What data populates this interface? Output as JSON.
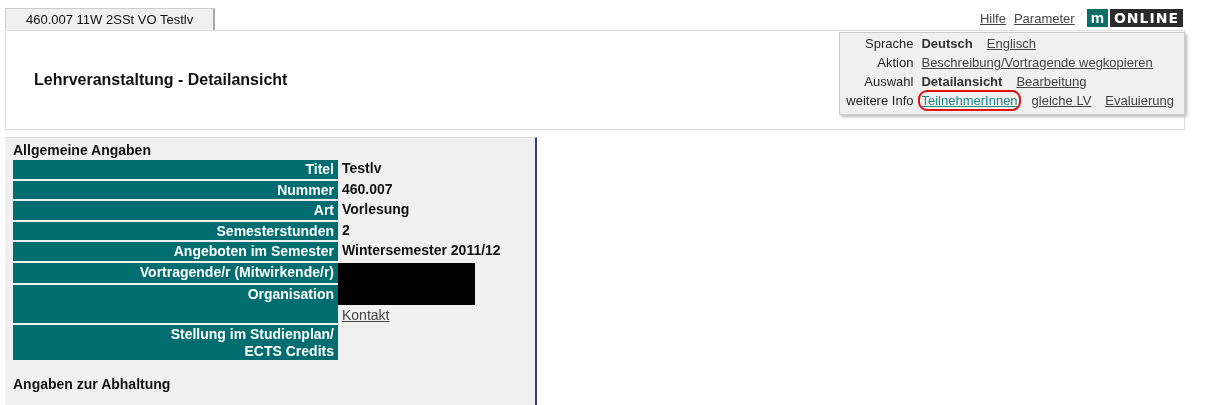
{
  "tab": {
    "label": "460.007 11W 2SSt VO Testlv",
    "selected": true
  },
  "top_links": [
    "Hilfe",
    "Parameter"
  ],
  "logo": {
    "mark": "m",
    "text": "ONLINE"
  },
  "page_title": "Lehrveranstaltung - Detailansicht",
  "menu": [
    {
      "label": "Sprache",
      "items": [
        {
          "text": "Deutsch",
          "selected": true,
          "highlighted": false
        },
        {
          "text": "Englisch",
          "selected": false,
          "highlighted": false
        }
      ]
    },
    {
      "label": "Aktion",
      "items": [
        {
          "text": "Beschreibung/Vortragende wegkopieren",
          "selected": false,
          "highlighted": false
        }
      ]
    },
    {
      "label": "Auswahl",
      "items": [
        {
          "text": "Detailansicht",
          "selected": true,
          "highlighted": false
        },
        {
          "text": "Bearbeitung",
          "selected": false,
          "highlighted": false
        }
      ]
    },
    {
      "label": "weitere Info",
      "items": [
        {
          "text": "TeilnehmerInnen",
          "selected": false,
          "highlighted": true
        },
        {
          "text": "gleiche LV",
          "selected": false,
          "highlighted": false
        },
        {
          "text": "Evaluierung",
          "selected": false,
          "highlighted": false
        }
      ]
    }
  ],
  "sections": [
    {
      "heading": "Allgemeine Angaben",
      "rows": [
        {
          "label": [
            "Titel"
          ],
          "values": [
            {
              "kind": "text",
              "text": "Testlv"
            }
          ]
        },
        {
          "label": [
            "Nummer"
          ],
          "values": [
            {
              "kind": "text",
              "text": "460.007"
            }
          ]
        },
        {
          "label": [
            "Art"
          ],
          "values": [
            {
              "kind": "text",
              "text": "Vorlesung"
            }
          ]
        },
        {
          "label": [
            "Semesterstunden"
          ],
          "values": [
            {
              "kind": "text",
              "text": "2"
            }
          ]
        },
        {
          "label": [
            "Angeboten im Semester"
          ],
          "values": [
            {
              "kind": "text",
              "text": "Wintersemester 2011/12"
            }
          ]
        },
        {
          "label": [
            "Vortragende/r (Mitwirkende/r)"
          ],
          "values": [
            {
              "kind": "redacted"
            }
          ]
        },
        {
          "label": [
            "Organisation"
          ],
          "values": [
            {
              "kind": "redacted"
            },
            {
              "kind": "link",
              "text": "Kontakt"
            }
          ]
        },
        {
          "label": [
            "Stellung im Studienplan/",
            "ECTS Credits"
          ],
          "values": []
        }
      ]
    },
    {
      "heading": "Angaben zur Abhaltung"
    }
  ]
}
